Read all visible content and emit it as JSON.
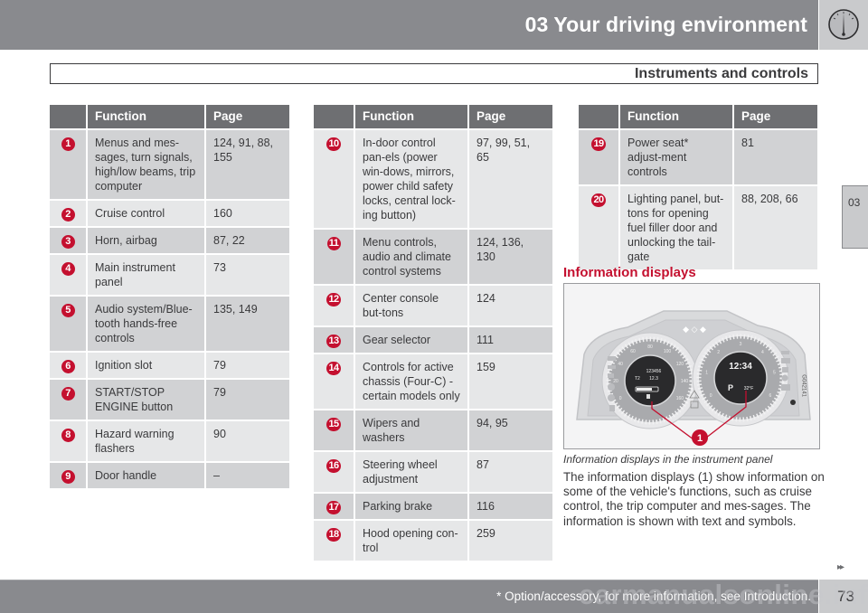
{
  "header": {
    "chapter_title": "03 Your driving environment",
    "chapter_icon": "gauge-icon",
    "section_title": "Instruments and controls",
    "side_tab": "03"
  },
  "tables": [
    {
      "columns": [
        "",
        "Function",
        "Page"
      ],
      "rows": [
        {
          "num": "1",
          "function": "Menus and mes-sages, turn signals, high/low beams, trip computer",
          "page": "124, 91, 88, 155"
        },
        {
          "num": "2",
          "function": "Cruise control",
          "page": "160"
        },
        {
          "num": "3",
          "function": "Horn, airbag",
          "page": "87, 22"
        },
        {
          "num": "4",
          "function": "Main instrument panel",
          "page": "73"
        },
        {
          "num": "5",
          "function": "Audio system/Blue-tooth hands-free controls",
          "page": "135, 149"
        },
        {
          "num": "6",
          "function": "Ignition slot",
          "page": "79"
        },
        {
          "num": "7",
          "function": "START/STOP ENGINE button",
          "page": "79"
        },
        {
          "num": "8",
          "function": "Hazard warning flashers",
          "page": "90"
        },
        {
          "num": "9",
          "function": "Door handle",
          "page": "–"
        }
      ]
    },
    {
      "columns": [
        "",
        "Function",
        "Page"
      ],
      "rows": [
        {
          "num": "10",
          "function": "In-door control pan-els (power win-dows, mirrors, power child safety locks, central lock-ing button)",
          "page": "97, 99, 51, 65"
        },
        {
          "num": "11",
          "function": "Menu controls, audio and climate control systems",
          "page": "124, 136, 130"
        },
        {
          "num": "12",
          "function": "Center console but-tons",
          "page": "124"
        },
        {
          "num": "13",
          "function": "Gear selector",
          "page": "111"
        },
        {
          "num": "14",
          "function": "Controls for active chassis (Four-C) - certain models only",
          "page": "159"
        },
        {
          "num": "15",
          "function": "Wipers and washers",
          "page": "94, 95"
        },
        {
          "num": "16",
          "function": "Steering wheel adjustment",
          "page": "87"
        },
        {
          "num": "17",
          "function": "Parking brake",
          "page": "116"
        },
        {
          "num": "18",
          "function": "Hood opening con-trol",
          "page": "259"
        }
      ]
    },
    {
      "columns": [
        "",
        "Function",
        "Page"
      ],
      "rows": [
        {
          "num": "19",
          "function": "Power seat* adjust-ment controls",
          "page": "81"
        },
        {
          "num": "20",
          "function": "Lighting panel, but-tons for opening fuel filler door and unlocking the tail-gate",
          "page": "88, 208, 66"
        }
      ]
    }
  ],
  "info": {
    "heading": "Information displays",
    "figure": {
      "code": "G042141",
      "callout": "1",
      "left_display": {
        "odometer": "123456",
        "trip_label": "T2",
        "trip_value": "12.3"
      },
      "right_display": {
        "clock": "12:34",
        "gear": "P",
        "temperature": "32°F"
      },
      "speed_ticks": [
        "0",
        "20",
        "40",
        "60",
        "80",
        "100",
        "120",
        "140",
        "160"
      ],
      "rpm_ticks": [
        "0",
        "1",
        "2",
        "3",
        "4",
        "5",
        "6"
      ]
    },
    "caption": "Information displays in the instrument panel",
    "body": "The information displays (1) show information on some of the vehicle's functions, such as cruise control, the trip computer and mes-sages. The information is shown with text and symbols."
  },
  "footer": {
    "next_arrows": "▸▸",
    "footnote": "* Option/accessory, for more information, see Introduction.",
    "page_number": "73",
    "watermark": "carmanualsonline.info"
  },
  "colors": {
    "accent_red": "#c4102f",
    "header_gray": "#898a8e",
    "table_header": "#6e6f72",
    "row_dark": "#d1d2d4",
    "row_light": "#e6e7e8"
  }
}
